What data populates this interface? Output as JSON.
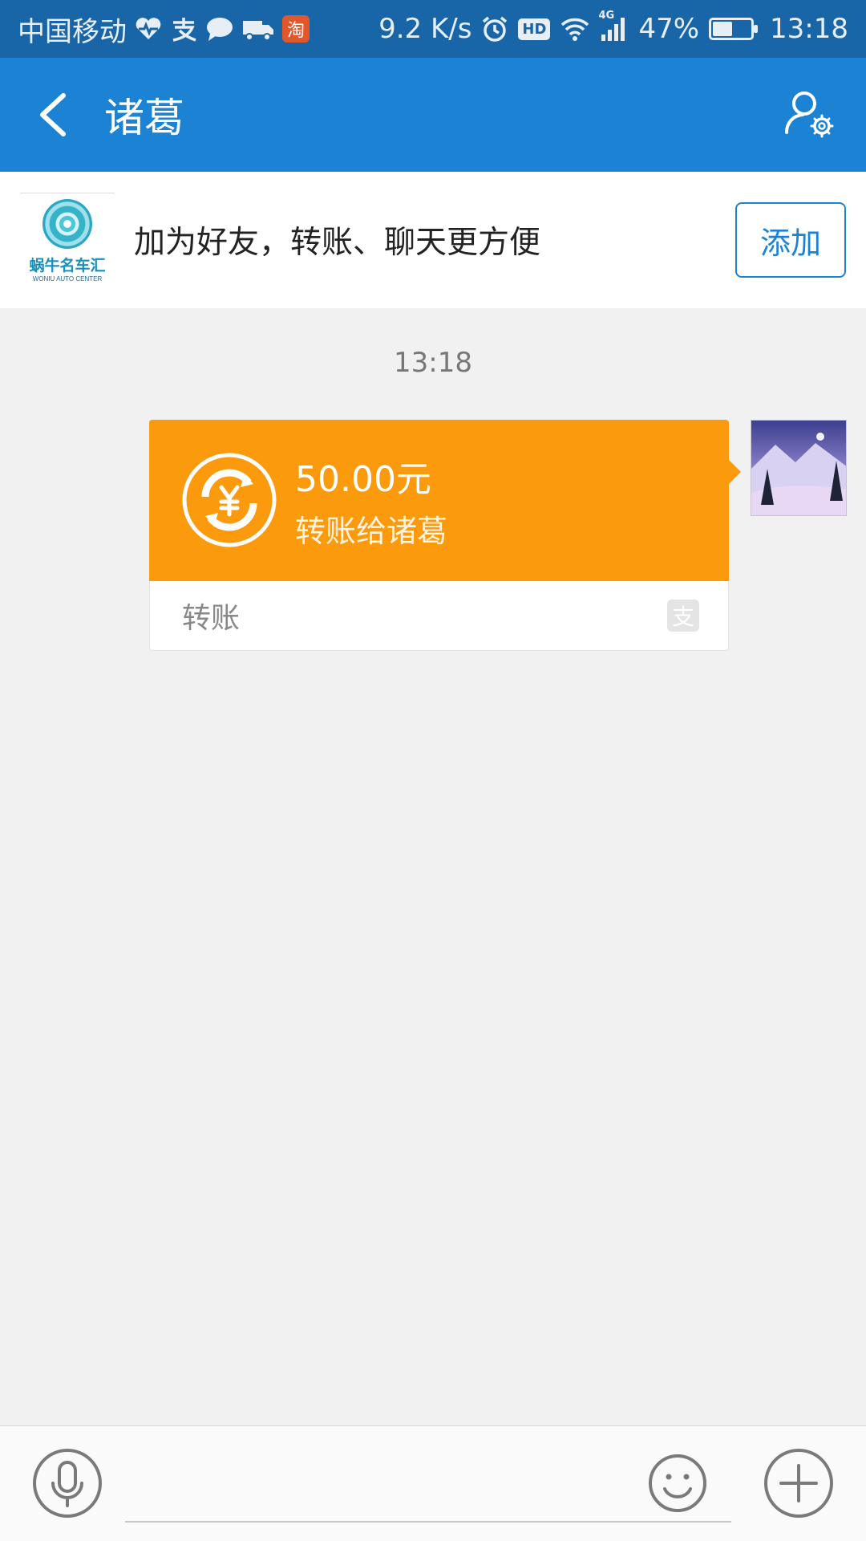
{
  "status_bar": {
    "carrier": "中国移动",
    "net_speed": "9.2 K/s",
    "hd_label": "HD",
    "network_type": "4G",
    "battery": "47%",
    "battery_level": 0.47,
    "time": "13:18",
    "taobao_label": "淘"
  },
  "header": {
    "title": "诸葛"
  },
  "friend_banner": {
    "logo_cn": "蜗牛名车汇",
    "logo_en": "WONIU AUTO CENTER",
    "text": "加为好友，转账、聊天更方便",
    "add_label": "添加"
  },
  "chat": {
    "timestamp": "13:18",
    "messages": [
      {
        "type": "transfer",
        "amount": "50.00元",
        "description": "转账给诸葛",
        "card_type": "转账",
        "brand_glyph": "支"
      }
    ]
  },
  "input_bar": {
    "placeholder": ""
  },
  "colors": {
    "status_bar": "#1866a8",
    "title_bar": "#1c83d4",
    "transfer_orange": "#fc9a0e",
    "background": "#f1f1f1"
  },
  "icons": [
    "heart-pulse-icon",
    "alipay-icon",
    "chat-bubble-icon",
    "truck-icon",
    "taobao-icon",
    "alarm-icon",
    "wifi-icon",
    "signal-icon",
    "battery-icon",
    "back-arrow-icon",
    "profile-settings-icon",
    "yuan-transfer-icon",
    "microphone-icon",
    "emoji-icon",
    "plus-icon"
  ]
}
